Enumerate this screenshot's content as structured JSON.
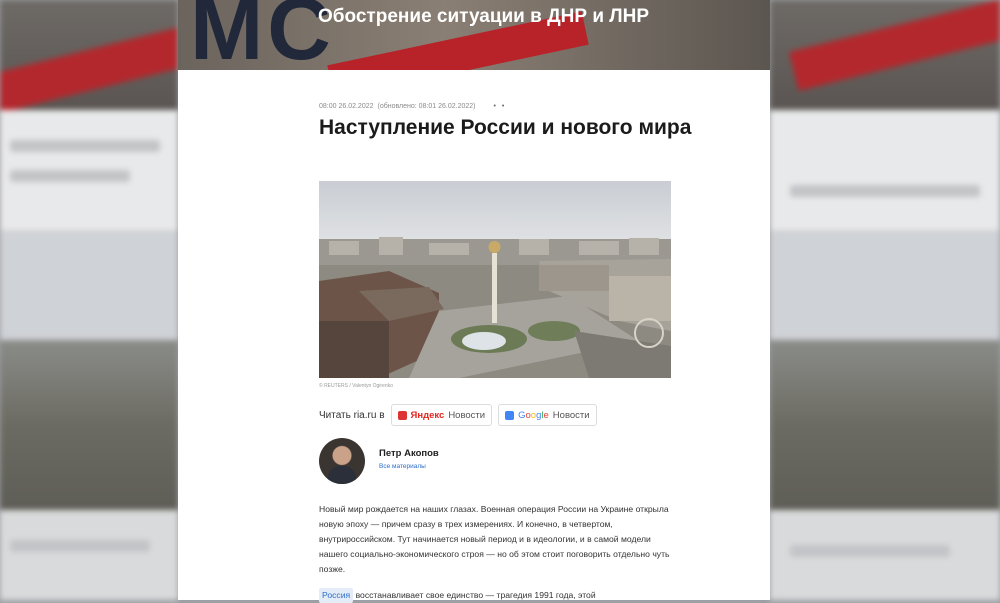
{
  "header": {
    "logo_text": "МС",
    "section_title": "Обострение ситуации в ДНР и ЛНР"
  },
  "article": {
    "meta": {
      "published": "08:00 26.02.2022",
      "updated": "(обновлено: 08:01 26.02.2022)",
      "dots": "• •"
    },
    "title": "Наступление России и нового мира",
    "photo_caption": "© REUTERS / Valentyn Ogirenko",
    "read_on": {
      "label": "Читать ria.ru в",
      "yandex_brand": "Яндекс",
      "yandex_suffix": "Новости",
      "google_brand": [
        "G",
        "o",
        "o",
        "g",
        "l",
        "e"
      ],
      "google_suffix": "Новости"
    },
    "author": {
      "name": "Петр Акопов",
      "link": "Все материалы"
    },
    "body": "Новый мир рождается на наших глазах. Военная операция России на Украине открыла новую эпоху — причем сразу в трех измерениях. И конечно, в четвертом, внутрироссийском. Тут начинается новый период и в идеологии, и в самой модели нашего социально-экономического строя — но об этом стоит поговорить отдельно чуть позже.",
    "body2_tag": "Россия",
    "body2_text": "восстанавливает свое единство — трагедия 1991 года, этой"
  }
}
